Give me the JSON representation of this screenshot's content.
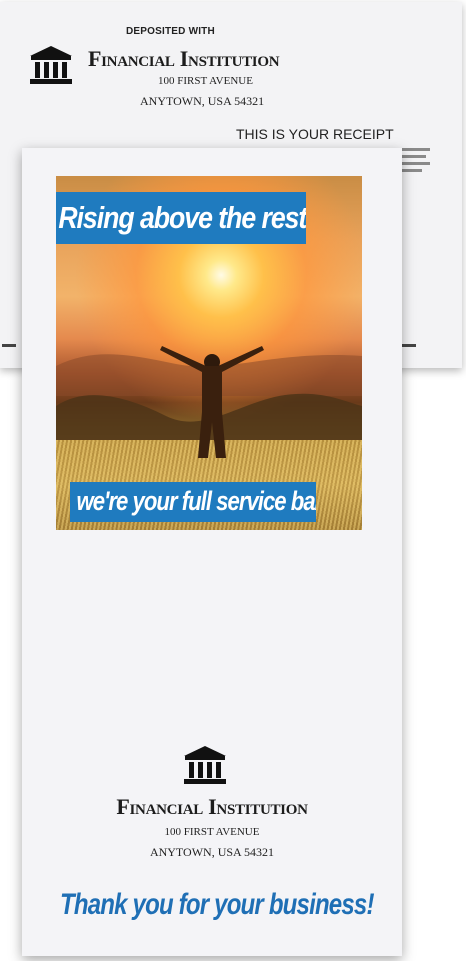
{
  "receipt": {
    "deposited_label": "DEPOSITED WITH",
    "institution_name": "Financial Institution",
    "address_line1": "100 First Avenue",
    "address_line2": "Anytown, USA 54321",
    "receipt_title": "THIS IS YOUR RECEIPT",
    "icon": "bank-building-icon"
  },
  "envelope": {
    "banner_top": "Rising above the rest...",
    "banner_bottom": "we're your full service bank.",
    "institution_name": "Financial Institution",
    "address_line1": "100 First Avenue",
    "address_line2": "Anytown, USA 54321",
    "thank_you": "Thank you for your business!",
    "icon": "bank-building-icon"
  },
  "colors": {
    "banner_blue": "#1f7bbf",
    "thank_you_blue": "#1f6fb5",
    "paper": "#f4f4f7"
  }
}
